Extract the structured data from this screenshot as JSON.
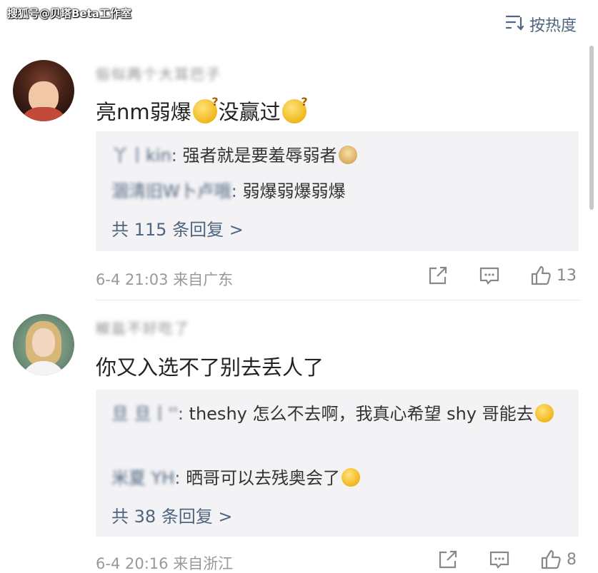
{
  "watermark": "搜狐号@贝塔Beta工作室",
  "sort": {
    "label": "按热度"
  },
  "comments": [
    {
      "username": "俗似两个大耳巴子",
      "text": "亮nm弱爆",
      "text2": "没赢过",
      "replies": [
        {
          "user": "丫丨kin",
          "text": "强者就是要羞辱弱者"
        },
        {
          "user": "涸淸旧W卜卢哦",
          "text": "弱爆弱爆弱爆"
        }
      ],
      "more": "共 115 条回复 >",
      "time": "6-4 21:03",
      "location": "来自广东",
      "likes": "13"
    },
    {
      "username": "椒盐不好吃了",
      "text": "你又入选不了别去丢人了",
      "replies": [
        {
          "user": "旦 旦丨''",
          "text": "theshy 怎么不去啊，我真心希望 shy 哥能去"
        },
        {
          "user": "米夏 YH",
          "text": "晒哥可以去残奥会了"
        }
      ],
      "more": "共 38 条回复 >",
      "time": "6-4 20:16",
      "location": "来自浙江",
      "likes": "8"
    }
  ]
}
